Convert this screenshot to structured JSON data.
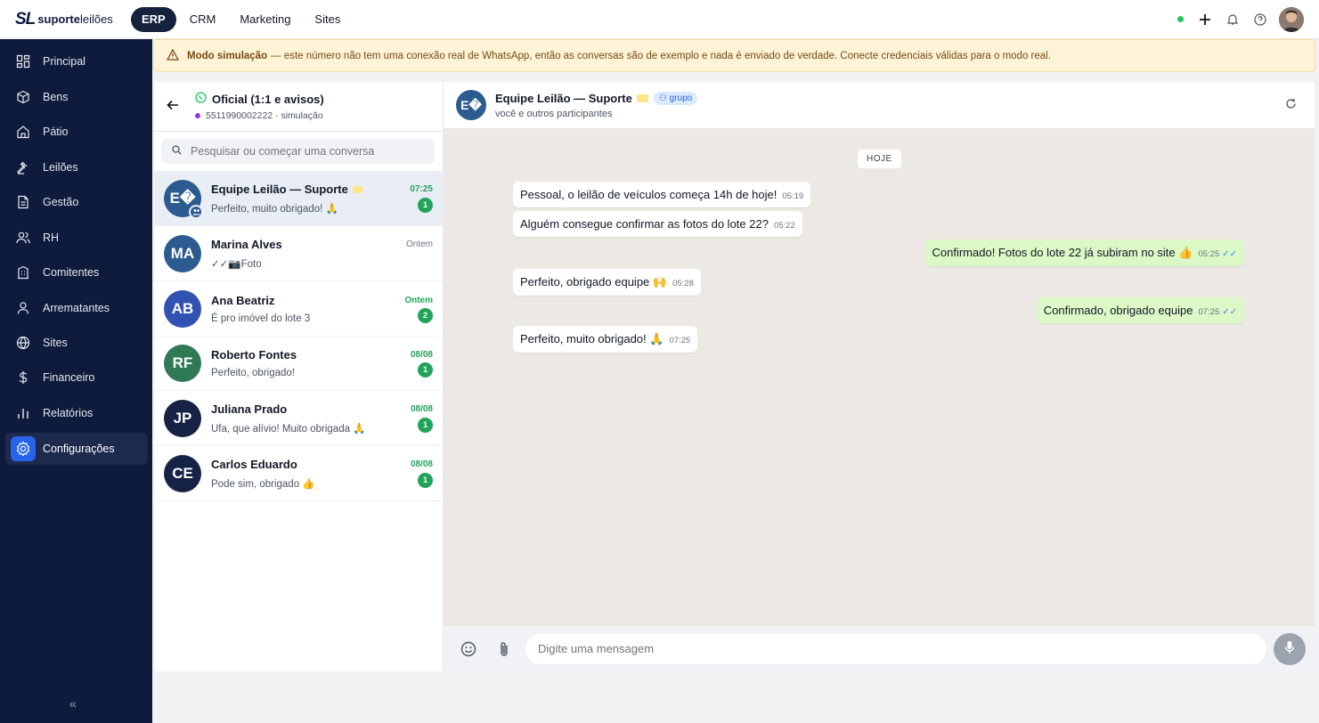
{
  "app": {
    "logo_mark": "SL",
    "logo_bold": "suporte",
    "logo_rest": "leilões"
  },
  "topnav": {
    "tabs": [
      "ERP",
      "CRM",
      "Marketing",
      "Sites"
    ],
    "active": "ERP"
  },
  "sidebar": {
    "items": [
      {
        "label": "Principal",
        "icon": "grid-icon"
      },
      {
        "label": "Bens",
        "icon": "box-icon"
      },
      {
        "label": "Pátio",
        "icon": "home-icon"
      },
      {
        "label": "Leilões",
        "icon": "gavel-icon"
      },
      {
        "label": "Gestão",
        "icon": "document-icon"
      },
      {
        "label": "RH",
        "icon": "users-icon"
      },
      {
        "label": "Comitentes",
        "icon": "building-icon"
      },
      {
        "label": "Arrematantes",
        "icon": "user-icon"
      },
      {
        "label": "Sites",
        "icon": "globe-icon"
      },
      {
        "label": "Financeiro",
        "icon": "dollar-icon"
      },
      {
        "label": "Relatórios",
        "icon": "bar-chart-icon"
      },
      {
        "label": "Configurações",
        "icon": "gear-icon",
        "active": true
      }
    ],
    "collapse_glyph": "«"
  },
  "banner": {
    "title": "Modo simulação",
    "text": "— este número não tem uma conexão real de WhatsApp, então as conversas são de exemplo e nada é enviado de verdade. Conecte credenciais válidas para o modo real."
  },
  "inbox": {
    "title": "Oficial (1:1 e avisos)",
    "subtitle": "5511990002222 · simulação",
    "search_placeholder": "Pesquisar ou começar uma conversa",
    "conversations": [
      {
        "initials": "E�",
        "name": "Equipe Leilão — Suporte",
        "time": "07:25",
        "preview": "Perfeito, muito obrigado! 🙏",
        "unread": "1",
        "color": "#2c5b8f",
        "active": true
      },
      {
        "initials": "MA",
        "name": "Marina Alves",
        "time": "Ontem",
        "preview": "✓✓📷Foto",
        "unread": "",
        "color": "#2c5b8f"
      },
      {
        "initials": "AB",
        "name": "Ana Beatriz",
        "time": "Ontem",
        "preview": "É pro imóvel do lote 3",
        "unread": "2",
        "color": "#3151b3"
      },
      {
        "initials": "RF",
        "name": "Roberto Fontes",
        "time": "08/08",
        "preview": "Perfeito, obrigado!",
        "unread": "1",
        "color": "#2f7a55"
      },
      {
        "initials": "JP",
        "name": "Juliana Prado",
        "time": "08/08",
        "preview": "Ufa, que alívio! Muito obrigada 🙏",
        "unread": "1",
        "color": "#172247"
      },
      {
        "initials": "CE",
        "name": "Carlos Eduardo",
        "time": "08/08",
        "preview": "Pode sim, obrigado 👍",
        "unread": "1",
        "color": "#172247"
      }
    ]
  },
  "chat": {
    "avatar": "E�",
    "name": "Equipe Leilão — Suporte",
    "group_badge": "grupo",
    "subtitle": "você e outros participantes",
    "day": "HOJE",
    "messages": [
      {
        "text": "Pessoal, o leilão de veículos começa 14h de hoje!",
        "time": "05:19",
        "dir": "in"
      },
      {
        "text": "Alguém consegue confirmar as fotos do lote 22?",
        "time": "05:22",
        "dir": "in"
      },
      {
        "text": "Confirmado! Fotos do lote 22 já subiram no site 👍",
        "time": "05:25",
        "dir": "out"
      },
      {
        "text": "Perfeito, obrigado equipe 🙌",
        "time": "05:28",
        "dir": "in"
      },
      {
        "text": "Confirmado, obrigado equipe",
        "time": "07:25",
        "dir": "out"
      },
      {
        "text": "Perfeito, muito obrigado! 🙏",
        "time": "07:25",
        "dir": "in"
      }
    ],
    "composer_placeholder": "Digite uma mensagem"
  }
}
